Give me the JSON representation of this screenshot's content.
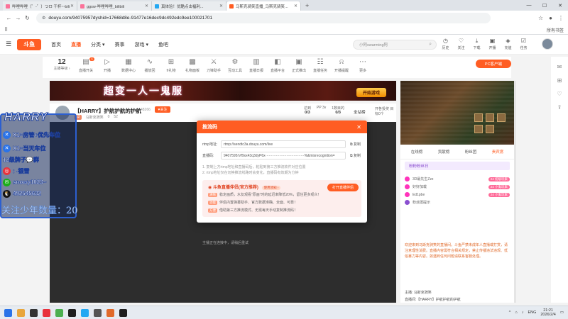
{
  "browser": {
    "tabs": [
      {
        "label": "哔哩哔哩（゜-゜）つロ 干杯~-bili",
        "icon_color": "#fb7299"
      },
      {
        "label": "ggsw-哔哩哔哩_bilibili",
        "icon_color": "#fb7299"
      },
      {
        "label": "真体验！优酷点击福利... ",
        "icon_color": "#23a8f2"
      },
      {
        "label": "马斯克骑笑直播_马斯克骑笑...",
        "icon_color": "#ff5d23"
      }
    ],
    "new_tab": "+",
    "window_controls": [
      "—",
      "☐",
      "✕"
    ],
    "url": "douyu.com/94075957dyshid=17668d8e-91477e16dec9dc492edc9ee100021701",
    "all_bookmarks": "所有书签"
  },
  "header": {
    "logo": "斗鱼",
    "nav": [
      "首页",
      "直播",
      "分类 ▾",
      "赛事",
      "游戏 ▾",
      "鱼吧"
    ],
    "search_placeholder": "小阿swarming阿",
    "tools": [
      {
        "label": "历史",
        "icon": "history-icon"
      },
      {
        "label": "关注",
        "icon": "heart-icon"
      },
      {
        "label": "下载",
        "icon": "download-icon"
      },
      {
        "label": "开播",
        "icon": "camera-icon"
      },
      {
        "label": "充值",
        "icon": "wallet-icon"
      },
      {
        "label": "任务",
        "icon": "task-icon"
      }
    ]
  },
  "category_strip": {
    "level_num": "12",
    "level_label": "主播等级 ›",
    "items": [
      {
        "label": "直播开关",
        "badge": "1"
      },
      {
        "label": "开播"
      },
      {
        "label": "数据中心"
      },
      {
        "label": "播放回"
      },
      {
        "label": "fr礼物"
      },
      {
        "label": "礼物面板"
      },
      {
        "label": "刀锋助手"
      },
      {
        "label": "互动工具"
      },
      {
        "label": "直播日报"
      },
      {
        "label": "直播平台"
      },
      {
        "label": "正式推出"
      },
      {
        "label": "直播任务"
      },
      {
        "label": "开播提醒"
      },
      {
        "label": "更多"
      }
    ],
    "pc_client": "PC客户端"
  },
  "banner": {
    "text": "超变一人一鬼服",
    "play_button": "开始游戏"
  },
  "room": {
    "title": "【HARRY】护航护航的护航",
    "room_id": "48266",
    "follow": "关注",
    "level": "12",
    "streamer": "马斯克骑笑",
    "meta1": "0",
    "meta2": "52",
    "stats": [
      {
        "label": "达到",
        "value": "0/3",
        "extra": "PP 3v"
      },
      {
        "label": "1数目的",
        "value": "0/3"
      }
    ],
    "all_categories": "全站榜",
    "goal": "开各投奖 目标0个"
  },
  "player": {
    "message": "主播正在连接中，请稍后重试"
  },
  "overlay": {
    "name": "HARRY",
    "lines": [
      {
        "text": "X1=房管+优先车位",
        "icon_char": "✕",
        "icon_color": "#2a73e8"
      },
      {
        "text": "X1=当天车位",
        "icon_char": "✕",
        "icon_color": "#2a73e8"
      },
      {
        "text": "12级牌子💬群",
        "icon_char": "",
        "icon_color": "transparent"
      },
      {
        "text": ": -银雪",
        "icon_char": "◎",
        "icon_color": "#e8323c"
      },
      {
        "text": "snowy1023~",
        "icon_char": "✉",
        "icon_color": "#1aad19"
      },
      {
        "text": "492545632",
        "icon_char": "🐧",
        "icon_color": "#111111"
      }
    ],
    "fan_count": "关注少年数量：20"
  },
  "right_panel": {
    "tabs": [
      "在线榜",
      "贡献榜",
      "粉丝团",
      "贵宾席"
    ],
    "rows": [
      {
        "text": "粉丝团提示",
        "pill": ""
      },
      {
        "text": "3D最先生Zzz",
        "pill": "24 初级玩家"
      },
      {
        "text": "好好加载",
        "pill": "24 小鬼玩家"
      },
      {
        "text": "Ed1pbe",
        "pill": "24 小鬼玩家"
      }
    ],
    "fans_bar": "粉粉粉丝日",
    "notice": "欢迎来到马斯克骑笑的直播间。斗鱼严禁未成年人直播或打赏，请注意理性消费。直播内容需符合相关规定，禁止传播违法违规、低俗暴力等内容。如遇到任何问题请联系客服处理。",
    "chat_label": "主播:",
    "chat_name": "马斯克骑笑",
    "chat_msg": "直播间:【HARRY】护航护航的护航"
  },
  "modal": {
    "title": "推流码",
    "close": "✕",
    "rtmp_label": "rtmp地址:",
    "rtmp_value": "rtmp://sendtc3a.douyu.com/live",
    "key_label": "直播码:",
    "key_value": "9407595rVf9xx43q3dyP6x·································%&mixrecognition=",
    "copy": "复制",
    "tips": [
      "1. 复制上方rtmp地址和直播码后，粘贴到第三方推流软件对应位置",
      "2. rtmp地址仅在切换推流线路时会变化，直播码有效期为分钟"
    ],
    "promo_title": "斗鱼直播伴侣(官方推荐)",
    "promo_tag": "使用须知 ›",
    "promo_lines": [
      {
        "tag": "清晰",
        "text": "稳定画质，水友观看“原画”时的延迟率降低20%，留住更多观众！"
      },
      {
        "tag": "功能",
        "text": "伴侣内置弹幕助手、官方数据准确、全面、可靠！"
      },
      {
        "tag": "方便",
        "text": "借助第三方推流模式、无需每天手动复制推流码！"
      }
    ],
    "open_button": "打开直播伴侣"
  },
  "taskbar": {
    "lang": "ENG",
    "time": "21:21",
    "date": "2026/2/4",
    "apps": [
      "#2a73e8",
      "#e8a63c",
      "#333333",
      "#e8323c",
      "#4caf50",
      "#1e1e1e",
      "#23a8f2",
      "#555555",
      "#e06a2a",
      "#1e1e1e"
    ]
  }
}
